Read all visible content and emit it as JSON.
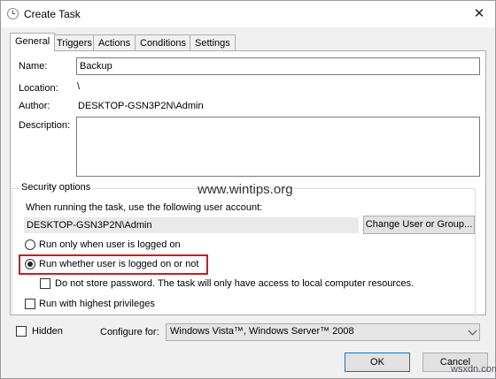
{
  "window": {
    "title": "Create Task",
    "close_glyph": "✕"
  },
  "tabs": [
    {
      "label": "General",
      "active": true
    },
    {
      "label": "Triggers"
    },
    {
      "label": "Actions"
    },
    {
      "label": "Conditions"
    },
    {
      "label": "Settings"
    }
  ],
  "general": {
    "name_label": "Name:",
    "name_value": "Backup",
    "location_label": "Location:",
    "location_value": "\\",
    "author_label": "Author:",
    "author_value": "DESKTOP-GSN3P2N\\Admin",
    "description_label": "Description:",
    "description_value": ""
  },
  "security": {
    "title": "Security options",
    "account_prompt": "When running the task, use the following user account:",
    "account_value": "DESKTOP-GSN3P2N\\Admin",
    "change_button": "Change User or Group...",
    "radio_logged_on": "Run only when user is logged on",
    "radio_whether": "Run whether user is logged on or not",
    "selected_radio": "whether",
    "no_store_password": "Do not store password.  The task will only have access to local computer resources.",
    "highest_privileges": "Run with highest privileges"
  },
  "footer": {
    "hidden_label": "Hidden",
    "configure_label": "Configure for:",
    "configure_value": "Windows Vista™, Windows Server™ 2008",
    "ok_label": "OK",
    "cancel_label": "Cancel"
  },
  "watermarks": {
    "site": "www.wintips.org",
    "corner": "wsxdn.com"
  },
  "colors": {
    "highlight": "#d01a1a",
    "button_face": "#e1e1e1",
    "focus_border": "#0078d7"
  }
}
